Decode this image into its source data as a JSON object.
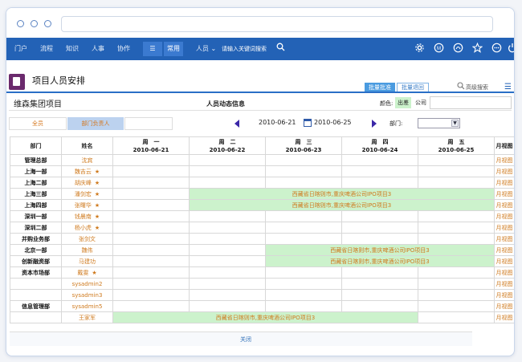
{
  "nav": {
    "items": [
      "门户",
      "流程",
      "知识",
      "人事",
      "协作"
    ],
    "common": "常用",
    "search_scope": "人员",
    "search_placeholder": "请输入关键词搜索"
  },
  "header": {
    "title": "项目人员安排",
    "tabs": [
      "批量批准",
      "批量退回"
    ],
    "advanced_search": "高级搜索"
  },
  "project": {
    "name": "维森集团项目",
    "center_title": "人员动态信息",
    "legend_label": "颜色:",
    "legend_out": "出差",
    "legend_company": "公司"
  },
  "filter": {
    "tab_all": "全员",
    "tab_leader": "部门负责人",
    "date_start": "2010-06-21",
    "date_end": "2010-06-25",
    "dept_label": "部门:"
  },
  "grid": {
    "headers": {
      "dept": "部门",
      "name": "姓名",
      "days": [
        {
          "week": "周　一",
          "date": "2010-06-21"
        },
        {
          "week": "周　二",
          "date": "2010-06-22"
        },
        {
          "week": "周　三",
          "date": "2010-06-23"
        },
        {
          "week": "周　四",
          "date": "2010-06-24"
        },
        {
          "week": "周　五",
          "date": "2010-06-25"
        }
      ],
      "month": "月视图"
    },
    "star": "★",
    "month_link": "月视图",
    "trip_text": "西藏省日喀则市,重庆啤酒公司IPO项目3",
    "rows": [
      {
        "dept": "管理总部",
        "name": "沈宾",
        "star": false,
        "bar": null
      },
      {
        "dept": "上海一部",
        "name": "魏吉云",
        "star": true,
        "bar": null
      },
      {
        "dept": "上海二部",
        "name": "胡庆峰",
        "star": true,
        "bar": null
      },
      {
        "dept": "上海三部",
        "name": "潘剑宏",
        "star": true,
        "bar": [
          1,
          4
        ]
      },
      {
        "dept": "上海四部",
        "name": "张曙华",
        "star": true,
        "bar": [
          1,
          4
        ]
      },
      {
        "dept": "深圳一部",
        "name": "钱晨南",
        "star": true,
        "bar": null
      },
      {
        "dept": "深圳二部",
        "name": "杨小虎",
        "star": true,
        "bar": null
      },
      {
        "dept": "并购业务部",
        "name": "张剑文",
        "star": false,
        "bar": null
      },
      {
        "dept": "北京一部",
        "name": "魏伟",
        "star": false,
        "bar": [
          2,
          4
        ]
      },
      {
        "dept": "创新融资部",
        "name": "马建功",
        "star": false,
        "bar": [
          2,
          4
        ]
      },
      {
        "dept": "资本市场部",
        "name": "戴雯",
        "star": true,
        "bar": null
      },
      {
        "dept": "",
        "name": "sysadmin2",
        "star": false,
        "bar": null
      },
      {
        "dept": "",
        "name": "sysadmin3",
        "star": false,
        "bar": null
      },
      {
        "dept": "信息管理部",
        "name": "sysadmin5",
        "star": false,
        "bar": null
      },
      {
        "dept": "",
        "name": "王家军",
        "star": false,
        "bar": [
          0,
          3
        ]
      }
    ]
  },
  "footer": {
    "close_label": "关闭"
  },
  "colors": {
    "nav_bg": "#2362b6",
    "accent": "#cf7a1e",
    "trip_bg": "#ccf2cc"
  }
}
